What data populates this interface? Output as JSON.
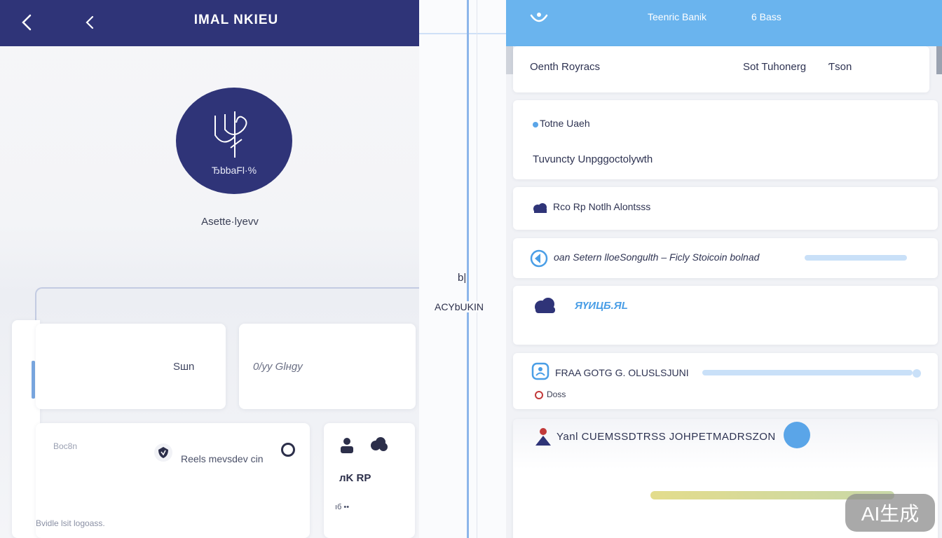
{
  "left": {
    "title": "IMAL NKIEU",
    "avatar": {
      "text": "ЂbbaFl·%",
      "caption": "Asette·lyevv"
    },
    "cards": {
      "card_a_label": "Sшn",
      "card_b_label": "0/yy Glнgy",
      "card_c_top_label": "Boc8n",
      "card_c_row_label": "Reels mevsdev cin",
      "card_c_footer": "Bvidle lsit logoass.",
      "card_d_label": "лK RP",
      "card_d_footer": "ıб ••"
    }
  },
  "middle": {
    "label": "ACYbUKIN",
    "glyph": "b|"
  },
  "right": {
    "header": {
      "title": "Teenric Banik",
      "meta": "6 Bass"
    },
    "row1": {
      "left": "Oenth Royracs",
      "right": "Sot Tuhonerg",
      "extra": "Ƭson"
    },
    "row2": {
      "top": "Totne Uaeh",
      "bottom": "Tuvuncty Unpggoctolywth"
    },
    "row3": {
      "text": "Rco Rp Notlh Alontsss"
    },
    "row4": {
      "text": "oan Setern lloeSongulth –   Ficly Stoicoin bolnad"
    },
    "row5": {
      "text": "ЯҮИЦБ.ЯL"
    },
    "row6": {
      "text": "FRAA   GOTG G. OLUSLSJUNI",
      "sub": "Doss"
    },
    "row7": {
      "text": "Yanl CUEMSSDTRSS JOHPETMADRSZON"
    },
    "colors": {
      "accent": "#6ab4ee",
      "bar_blue": "#c9e0f8",
      "bar_yellow": "#e3dc8c",
      "navy": "#2f3478"
    }
  },
  "watermark": "AI生成"
}
